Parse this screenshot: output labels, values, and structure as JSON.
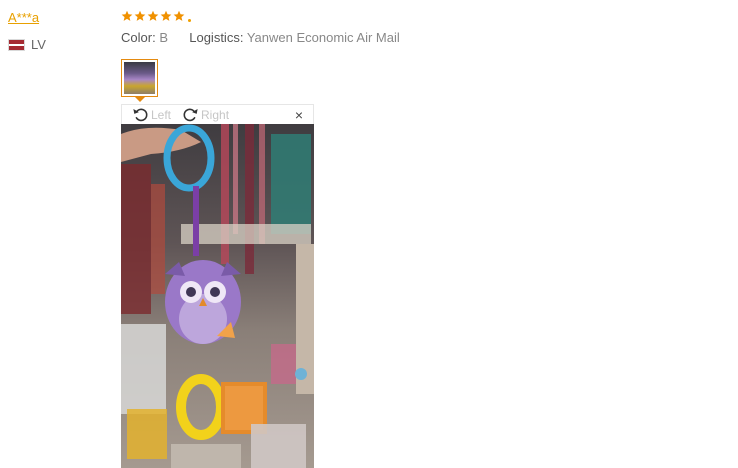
{
  "reviewer": {
    "name": "A***a",
    "country": "LV"
  },
  "review": {
    "rating": 5,
    "color_label": "Color:",
    "color_value": "B",
    "logistics_label": "Logistics:",
    "logistics_value": "Yanwen Economic Air Mail"
  },
  "viewer": {
    "rotate_left_label": "Left",
    "rotate_right_label": "Right",
    "close_label": "×"
  },
  "colors": {
    "star": "#f09100",
    "accent": "#e48a10",
    "name_link": "#e8a000"
  },
  "icons": [
    "star-icon",
    "flag-icon",
    "rotate-left-icon",
    "rotate-right-icon",
    "close-icon"
  ]
}
